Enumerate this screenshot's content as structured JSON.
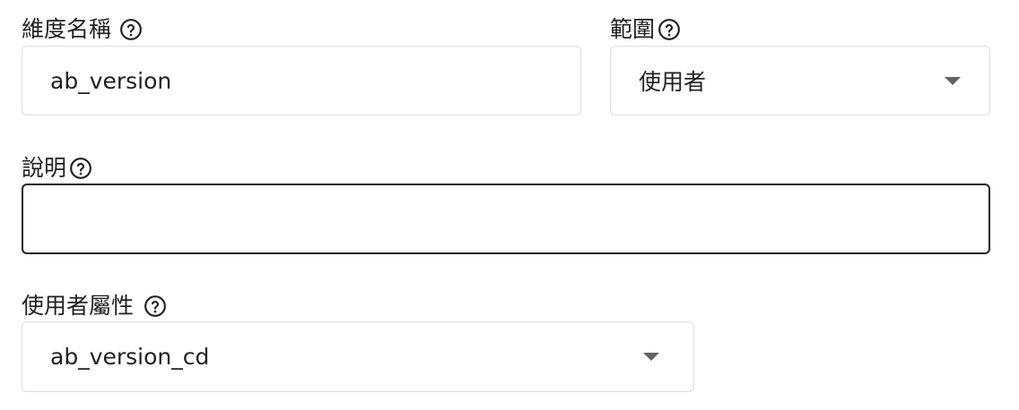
{
  "dimension_name": {
    "label": "維度名稱",
    "value": "ab_version",
    "help_icon": "help-circle-icon"
  },
  "scope": {
    "label": "範圍",
    "selected": "使用者",
    "help_icon": "help-circle-icon",
    "dropdown_icon": "arrow-drop-down-icon"
  },
  "description": {
    "label": "說明",
    "value": "",
    "help_icon": "help-circle-icon"
  },
  "user_property": {
    "label": "使用者屬性",
    "selected": "ab_version_cd",
    "help_icon": "help-circle-icon",
    "dropdown_icon": "arrow-drop-down-icon"
  },
  "colors": {
    "text": "#202124",
    "border": "#dadce0",
    "focused_border": "#202124",
    "icon": "#5f6368"
  }
}
